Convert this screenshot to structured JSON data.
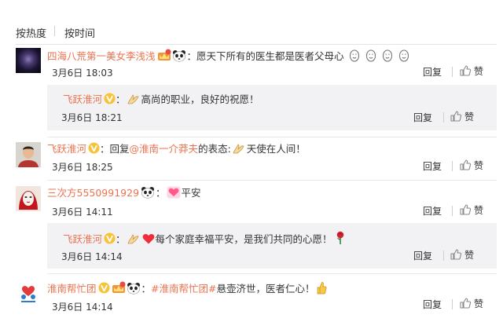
{
  "sort": {
    "hot": "按热度",
    "time": "按时间"
  },
  "actions": {
    "reply": "回复",
    "like": "赞"
  },
  "comments": [
    {
      "name": "四海八荒第一美女李浅浅",
      "text": "愿天下所有的医生都是医者父母心",
      "time": "3月6日 18:03",
      "reply": {
        "name": "飞跃淮河",
        "text": "高尚的职业，良好的祝愿！",
        "time": "3月6日 18:21"
      }
    },
    {
      "name": "飞跃淮河",
      "text_prefix": "回复",
      "mention": "@淮南一介莽夫",
      "text_mid": "的表态:",
      "text": "天使在人间！",
      "time": "3月6日 18:25"
    },
    {
      "name": "三次方5550991929",
      "text": "平安",
      "time": "3月6日 14:11",
      "reply": {
        "name": "飞跃淮河",
        "text": "每个家庭幸福平安，是我们共同的心愿！",
        "time": "3月6日 14:14"
      }
    },
    {
      "name": "淮南帮忙团",
      "hashtag": "#淮南帮忙团#",
      "text": "悬壶济世，医者仁心！",
      "time": "3月6日 14:14"
    }
  ],
  "icon_names": [
    "vip-v-badge",
    "panda-emoji",
    "praying-hands-emoji",
    "heart-emoji",
    "rose-emoji",
    "thumbs-up-emoji",
    "crown-badge"
  ]
}
